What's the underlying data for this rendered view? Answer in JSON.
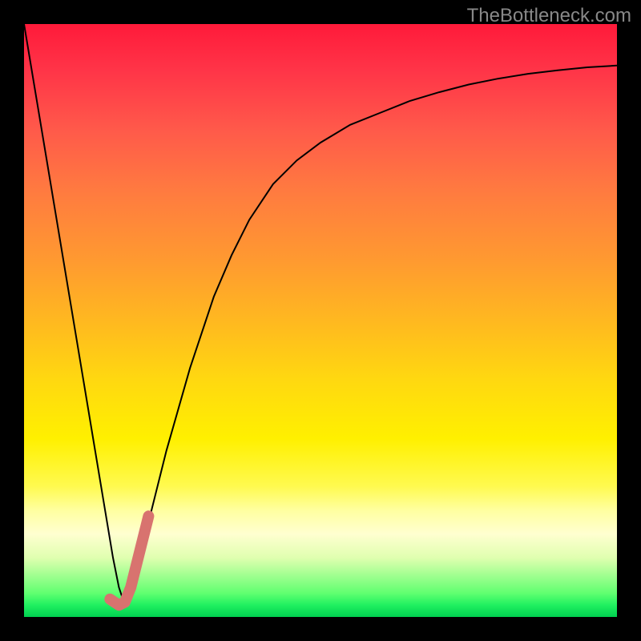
{
  "watermark": "TheBottleneck.com",
  "chart_data": {
    "type": "line",
    "title": "",
    "xlabel": "",
    "ylabel": "",
    "xlim": [
      0,
      100
    ],
    "ylim": [
      0,
      100
    ],
    "series": [
      {
        "name": "bottleneck-curve",
        "color": "#000000",
        "stroke_width": 2,
        "x": [
          0,
          2,
          4,
          6,
          8,
          10,
          12,
          14,
          15,
          16,
          17,
          18,
          20,
          22,
          24,
          26,
          28,
          30,
          32,
          35,
          38,
          42,
          46,
          50,
          55,
          60,
          65,
          70,
          75,
          80,
          85,
          90,
          95,
          100
        ],
        "y": [
          100,
          88,
          76,
          64,
          52,
          40,
          28,
          16,
          10,
          5,
          2,
          5,
          12,
          20,
          28,
          35,
          42,
          48,
          54,
          61,
          67,
          73,
          77,
          80,
          83,
          85,
          87,
          88.5,
          89.8,
          90.8,
          91.6,
          92.2,
          92.7,
          93
        ]
      },
      {
        "name": "highlight-segment",
        "color": "#d8736f",
        "stroke_width": 14,
        "linecap": "round",
        "x": [
          14.5,
          16,
          17,
          18,
          19,
          20,
          21
        ],
        "y": [
          3,
          2,
          2.5,
          5,
          9,
          13,
          17
        ]
      }
    ]
  }
}
